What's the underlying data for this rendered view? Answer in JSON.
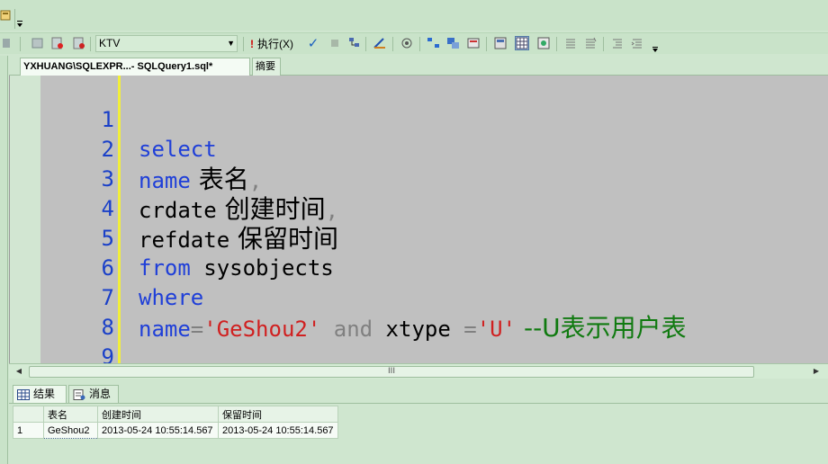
{
  "toolbar": {
    "database": "KTV",
    "execute_label": "执行(X)"
  },
  "tabs": {
    "query_tab": "YXHUANG\\SQLEXPR...- SQLQuery1.sql*",
    "summary_tab": "摘要"
  },
  "editor": {
    "lines": [
      {
        "n": "1",
        "a": "select",
        "b": "",
        "c": ""
      },
      {
        "n": "2",
        "a": "name",
        "b": " 表名",
        "c": ","
      },
      {
        "n": "3",
        "a": "crdate",
        "b": " 创建时间",
        "c": ","
      },
      {
        "n": "4",
        "a": "refdate",
        "b": " 保留时间",
        "c": ""
      },
      {
        "n": "5",
        "a": "from",
        "b": " sysobjects",
        "c": ""
      },
      {
        "n": "6",
        "a": "where",
        "b": "",
        "c": ""
      },
      {
        "n": "7",
        "a": "name",
        "b": "",
        "c": ""
      },
      {
        "n": "8",
        "a": "",
        "b": "",
        "c": ""
      },
      {
        "n": "9",
        "a": "",
        "b": "",
        "c": ""
      }
    ],
    "line7": {
      "kw": "name",
      "eq": "=",
      "str1": "'GeShou2'",
      "and": " and ",
      "xtype": "xtype ",
      "eq2": "=",
      "str2": "'U'",
      "comment": " --U表示用户表"
    }
  },
  "scrollbar": {
    "thumb_mark": "III"
  },
  "results_tabs": {
    "results": "结果",
    "messages": "消息"
  },
  "results": {
    "columns": [
      "表名",
      "创建时间",
      "保留时间"
    ],
    "rows": [
      {
        "num": "1",
        "cells": [
          "GeShou2",
          "2013-05-24 10:55:14.567",
          "2013-05-24 10:55:14.567"
        ]
      }
    ]
  }
}
